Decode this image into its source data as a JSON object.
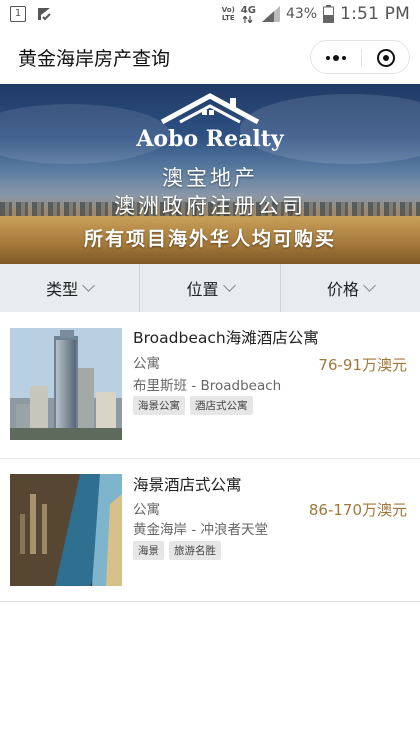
{
  "statusbar": {
    "sim_icon": "1",
    "notification_icon": "check-flag-icon",
    "volte": "Vol)\nLTE",
    "network": "4G",
    "battery_percent": "43%",
    "time": "1:51 PM"
  },
  "navbar": {
    "title": "黄金海岸房产查询"
  },
  "banner": {
    "brand": "Aobo Realty",
    "line1": "澳宝地产",
    "line2": "澳洲政府注册公司",
    "line3": "所有项目海外华人均可购买"
  },
  "filters": [
    {
      "label": "类型"
    },
    {
      "label": "位置"
    },
    {
      "label": "价格"
    }
  ],
  "listings": [
    {
      "title": "Broadbeach海滩酒店公寓",
      "type": "公寓",
      "location": "布里斯班 - Broadbeach",
      "tags": [
        "海景公寓",
        "酒店式公寓"
      ],
      "price": "76-91万澳元"
    },
    {
      "title": "海景酒店式公寓",
      "type": "公寓",
      "location": "黄金海岸 - 冲浪者天堂",
      "tags": [
        "海景",
        "旅游名胜"
      ],
      "price": "86-170万澳元"
    }
  ],
  "colors": {
    "price": "#a0783c",
    "filter_bg": "#e9ecef",
    "tag_bg": "#e6e6e6"
  }
}
